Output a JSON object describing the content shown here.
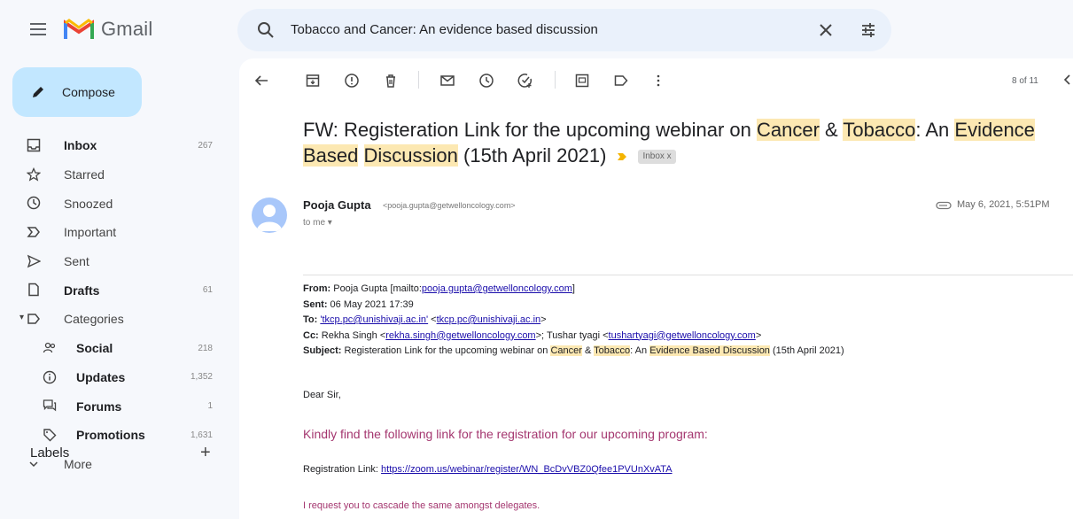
{
  "app": {
    "name": "Gmail"
  },
  "search": {
    "query": "Tobacco and Cancer: An evidence based discussion"
  },
  "compose": {
    "label": "Compose"
  },
  "nav": [
    {
      "name": "inbox",
      "label": "Inbox",
      "count": "267",
      "icon": "inbox-icon",
      "bold": true
    },
    {
      "name": "starred",
      "label": "Starred",
      "count": "",
      "icon": "star-icon",
      "bold": false
    },
    {
      "name": "snoozed",
      "label": "Snoozed",
      "count": "",
      "icon": "clock-icon",
      "bold": false
    },
    {
      "name": "important",
      "label": "Important",
      "count": "",
      "icon": "important-icon",
      "bold": false
    },
    {
      "name": "sent",
      "label": "Sent",
      "count": "",
      "icon": "send-icon",
      "bold": false
    },
    {
      "name": "drafts",
      "label": "Drafts",
      "count": "61",
      "icon": "draft-icon",
      "bold": true
    },
    {
      "name": "categories",
      "label": "Categories",
      "count": "",
      "icon": "label-icon",
      "bold": false
    },
    {
      "name": "social",
      "label": "Social",
      "count": "218",
      "icon": "people-icon",
      "bold": true
    },
    {
      "name": "updates",
      "label": "Updates",
      "count": "1,352",
      "icon": "info-icon",
      "bold": true
    },
    {
      "name": "forums",
      "label": "Forums",
      "count": "1",
      "icon": "forum-icon",
      "bold": true
    },
    {
      "name": "promotions",
      "label": "Promotions",
      "count": "1,631",
      "icon": "tag-icon",
      "bold": true
    },
    {
      "name": "more",
      "label": "More",
      "count": "",
      "icon": "chevron-down-icon",
      "bold": false
    }
  ],
  "labels": {
    "title": "Labels"
  },
  "toolbar": {
    "pager": "8 of 11"
  },
  "email": {
    "subject_parts": [
      {
        "text": "FW: Registeration Link for the upcoming webinar on ",
        "hl": false
      },
      {
        "text": "Cancer",
        "hl": true
      },
      {
        "text": " & ",
        "hl": false
      },
      {
        "text": "Tobacco",
        "hl": true
      },
      {
        "text": ": An ",
        "hl": false
      },
      {
        "text": "Evidence",
        "hl": true
      },
      {
        "text": " ",
        "hl": false
      },
      {
        "text": "Based",
        "hl": true
      },
      {
        "text": " ",
        "hl": false
      },
      {
        "text": "Discussion",
        "hl": true
      },
      {
        "text": " (15th April 2021)",
        "hl": false
      }
    ],
    "inbox_chip": "Inbox x",
    "sender_name": "Pooja Gupta",
    "sender_email": "<pooja.gupta@getwelloncology.com>",
    "to_me": "to me",
    "date": "May 6, 2021, 5:51PM",
    "from_label": "From:",
    "from_name": " Pooja Gupta [mailto:",
    "from_link": "pooja.gupta@getwelloncology.com",
    "from_close": "]",
    "sent_label": "Sent:",
    "sent_value": " 06 May 2021 17:39",
    "to_label": "To:",
    "to_link1": "'tkcp.pc@unishivaji.ac.in'",
    "to_mid": " <",
    "to_link2": "tkcp.pc@unishivaji.ac.in",
    "to_close": ">",
    "cc_label": "Cc:",
    "cc_name1": " Rekha Singh <",
    "cc_link1": "rekha.singh@getwelloncology.com",
    "cc_mid": ">; Tushar tyagi <",
    "cc_link2": "tushartyagi@getwelloncology.com",
    "cc_close": ">",
    "subj_label": "Subject:",
    "subj_parts": [
      {
        "text": " Registeration Link for the upcoming webinar on ",
        "hl": false
      },
      {
        "text": "Cancer",
        "hl": true
      },
      {
        "text": " & ",
        "hl": false
      },
      {
        "text": "Tobacco",
        "hl": true
      },
      {
        "text": ": An ",
        "hl": false
      },
      {
        "text": "Evidence Based Discussion",
        "hl": true
      },
      {
        "text": " (15th April 2021)",
        "hl": false
      }
    ],
    "greeting": "Dear Sir,",
    "line1": "Kindly find the following link for the registration for our upcoming program:",
    "reg_label": "Registration Link: ",
    "reg_link": "https://zoom.us/webinar/register/WN_BcDvVBZ0Qfee1PVUnXvATA",
    "cascade": "I request you to cascade the same amongst delegates."
  },
  "colors": {
    "compose_bg": "#c2e7ff",
    "search_bg": "#eaf1fb",
    "highlight": "#fce8b2",
    "link": "#1a0dab",
    "pink_text": "#a4366f",
    "important_marker": "#f4b400"
  }
}
